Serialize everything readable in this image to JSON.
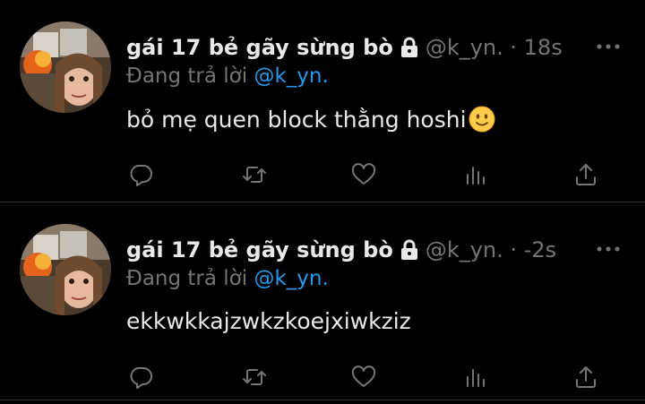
{
  "tweets": [
    {
      "name": "gái 17 bẻ gãy sừng bò",
      "handle": "@k_yn. · 18s",
      "reply_prefix": "Đang trả lời ",
      "reply_mention": "@k_yn.",
      "text": "bỏ mẹ quen block thằng hoshi",
      "emoji": "slightly-smiling-face"
    },
    {
      "name": "gái 17 bẻ gãy sừng bò",
      "handle": "@k_yn. · -2s",
      "reply_prefix": "Đang trả lời ",
      "reply_mention": "@k_yn.",
      "text": "ekkwkkajzwkzkoejxiwkziz"
    }
  ],
  "icons": {
    "verified_lock": "lock-icon",
    "more": "more-icon",
    "reply": "reply-icon",
    "retweet": "retweet-icon",
    "like": "like-icon",
    "views": "views-icon",
    "share": "share-icon"
  },
  "colors": {
    "background": "#000000",
    "text": "#e7e9ea",
    "secondary": "#71767b",
    "accent": "#1d9bf0",
    "divider": "#2f3336"
  }
}
